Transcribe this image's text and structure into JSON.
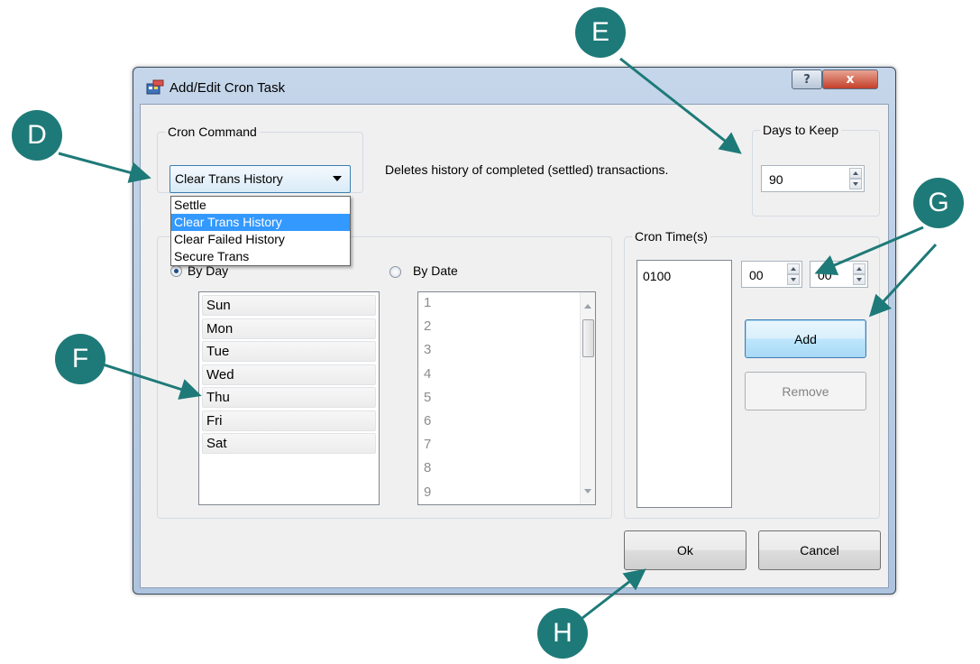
{
  "window": {
    "title": "Add/Edit Cron Task",
    "help_glyph": "?",
    "close_glyph": "x"
  },
  "cron_command": {
    "group_title": "Cron Command",
    "selected": "Clear Trans History",
    "description": "Deletes history of completed (settled) transactions.",
    "options": [
      "Settle",
      "Clear Trans History",
      "Clear Failed History",
      "Secure Trans"
    ]
  },
  "days_to_keep": {
    "group_title": "Days to Keep",
    "value": "90"
  },
  "schedule": {
    "by_day_label": "By Day",
    "by_date_label": "By Date",
    "days": [
      "Sun",
      "Mon",
      "Tue",
      "Wed",
      "Thu",
      "Fri",
      "Sat"
    ],
    "dates": [
      "1",
      "2",
      "3",
      "4",
      "5",
      "6",
      "7",
      "8",
      "9"
    ]
  },
  "cron_times": {
    "group_title": "Cron Time(s)",
    "entries": [
      "0100"
    ],
    "hour": "00",
    "minute": "00",
    "add_label": "Add",
    "remove_label": "Remove"
  },
  "footer": {
    "ok_label": "Ok",
    "cancel_label": "Cancel"
  },
  "callouts": {
    "d": "D",
    "e": "E",
    "f": "F",
    "g": "G",
    "h": "H"
  },
  "colors": {
    "callout": "#1e7a78",
    "selection": "#3399ff"
  }
}
